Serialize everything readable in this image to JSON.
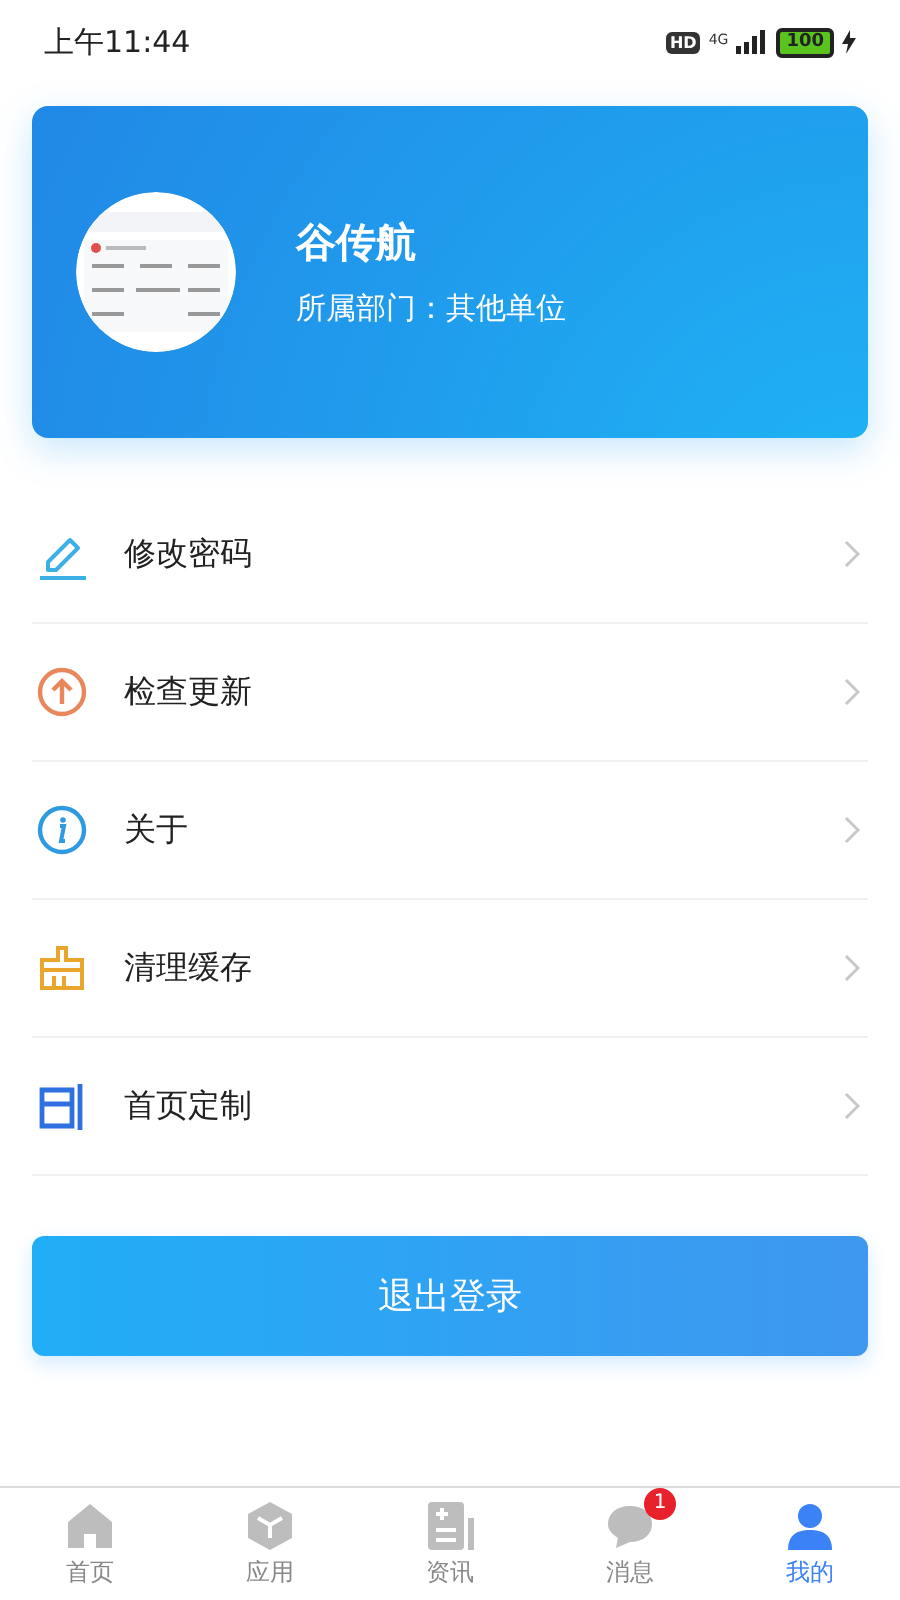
{
  "status_bar": {
    "time": "上午11:44",
    "hd": "HD",
    "network": "4G",
    "battery": "100",
    "charging": true
  },
  "profile": {
    "name": "谷传航",
    "department": "所属部门：其他单位"
  },
  "menu": [
    {
      "kind": "edit",
      "label": "修改密码"
    },
    {
      "kind": "update",
      "label": "检查更新"
    },
    {
      "kind": "info",
      "label": "关于"
    },
    {
      "kind": "clean",
      "label": "清理缓存"
    },
    {
      "kind": "layout",
      "label": "首页定制"
    }
  ],
  "logout_button": "退出登录",
  "tab_bar": [
    {
      "kind": "home",
      "label": "首页",
      "selected": false
    },
    {
      "kind": "apps",
      "label": "应用",
      "selected": false
    },
    {
      "kind": "news",
      "label": "资讯",
      "selected": false
    },
    {
      "kind": "message",
      "label": "消息",
      "selected": false,
      "badge": "1"
    },
    {
      "kind": "me",
      "label": "我的",
      "selected": true
    }
  ]
}
